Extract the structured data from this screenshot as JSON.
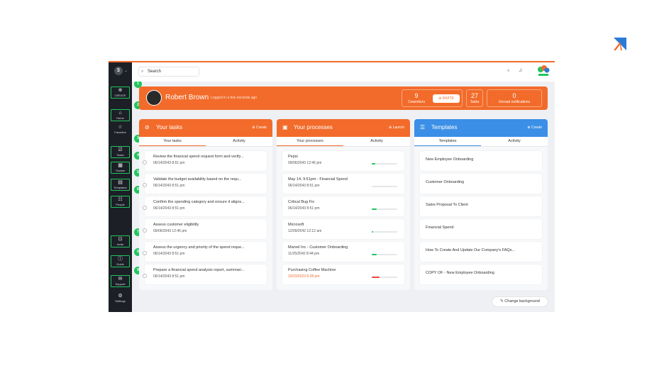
{
  "sidebar": {
    "items": [
      {
        "label": "CREATE",
        "glyph": "⊕",
        "icon": "plus-circle-icon"
      },
      {
        "label": "Home",
        "glyph": "⌂",
        "icon": "home-icon"
      },
      {
        "label": "Favorites",
        "glyph": "☆",
        "icon": "star-icon"
      },
      {
        "label": "Tasks",
        "glyph": "☑",
        "icon": "checkbox-icon"
      },
      {
        "label": "Tracker",
        "glyph": "▦",
        "icon": "grid-icon"
      },
      {
        "label": "Templates",
        "glyph": "▤",
        "icon": "templates-icon"
      },
      {
        "label": "People",
        "glyph": "☷",
        "icon": "people-icon"
      },
      {
        "label": "Invite",
        "glyph": "⊡",
        "icon": "invite-icon"
      },
      {
        "label": "Guide",
        "glyph": "ⓘ",
        "icon": "info-icon"
      },
      {
        "label": "Support",
        "glyph": "✉",
        "icon": "mail-icon"
      },
      {
        "label": "Settings",
        "glyph": "⚙",
        "icon": "gear-icon"
      }
    ]
  },
  "steps": [
    "1",
    "2",
    "3",
    "4",
    "5",
    "6",
    "7",
    "8",
    "9"
  ],
  "topbar": {
    "search_placeholder": "Search"
  },
  "banner": {
    "name": "Robert Brown",
    "status": "Logged in a few seconds ago",
    "coworkers": {
      "count": "9",
      "label": "Coworkers"
    },
    "invite": "⊕ INVITE",
    "tasks": {
      "count": "27",
      "label": "Tasks"
    },
    "notifications": {
      "count": "0",
      "label": "Unread notifications"
    }
  },
  "tasks_panel": {
    "title": "Your tasks",
    "action": "⊕ Create",
    "tabs": [
      "Your tasks",
      "Activity"
    ],
    "items": [
      {
        "title": "Review the financial spend request form and verify...",
        "date": "06/14/2043 8:51 pm"
      },
      {
        "title": "Validate the budget availability based on the requ...",
        "date": "06/14/2043 8:51 pm"
      },
      {
        "title": "Confirm the spending category and ensure it aligns...",
        "date": "06/14/2043 8:51 pm"
      },
      {
        "title": "Assess customer eligibility",
        "date": "09/06/2043 12:46 pm"
      },
      {
        "title": "Assess the urgency and priority of the spend reque...",
        "date": "06/14/2043 8:51 pm"
      },
      {
        "title": "Prepare a financial spend analysis report, summari...",
        "date": "06/14/2043 8:51 pm"
      }
    ]
  },
  "processes_panel": {
    "title": "Your processes",
    "action": "⊕ Launch",
    "tabs": [
      "Your processes",
      "Activity"
    ],
    "items": [
      {
        "title": "Pepsi",
        "date": "09/06/2043 12:46 pm",
        "progress": 0.15,
        "color": "#22c55e"
      },
      {
        "title": "May 14, 9:51pm - Financial Spend",
        "date": "06/14/2043 8:51 pm",
        "progress": 0.0,
        "color": "#22c55e"
      },
      {
        "title": "Critical Bug Fix",
        "date": "06/14/2043 8:51 pm",
        "progress": 0.2,
        "color": "#22c55e"
      },
      {
        "title": "Microsoft",
        "date": "12/09/2042 12:12 am",
        "progress": 0.05,
        "color": "#22c55e"
      },
      {
        "title": "Marvel Inc - Customer Onboarding",
        "date": "11/25/2042 8:44 pm",
        "progress": 0.2,
        "color": "#22c55e"
      },
      {
        "title": "Purchasing Coffee Machine",
        "date": "10/23/2023 6:28 pm",
        "progress": 0.3,
        "color": "#ef4444",
        "date_color": "#f26b2a"
      }
    ]
  },
  "templates_panel": {
    "title": "Templates",
    "action": "⊕ Create",
    "tabs": [
      "Templates",
      "Activity"
    ],
    "items": [
      {
        "title": "New Employee Onboarding"
      },
      {
        "title": "Customer Onboarding"
      },
      {
        "title": "Sales Proposal To Client"
      },
      {
        "title": "Financial Spend"
      },
      {
        "title": "How To Create And Update Our Company's FAQs..."
      },
      {
        "title": "COPY OF - New Employee Onboarding"
      }
    ]
  },
  "change_background": "✎ Change background",
  "colors": {
    "accent": "#f26b2a",
    "templates": "#3b8fe6",
    "sidebar": "#1c1f26",
    "step": "#22c55e"
  }
}
